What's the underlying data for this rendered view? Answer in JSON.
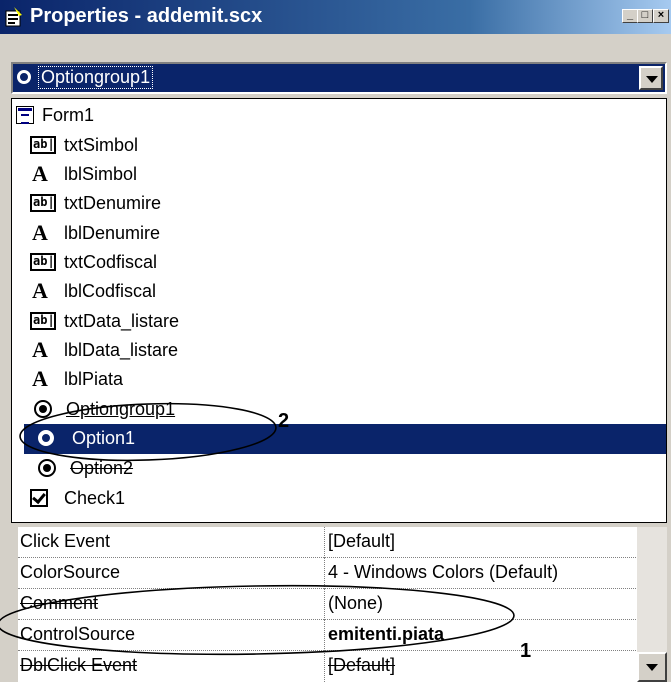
{
  "window": {
    "title": "Properties - addemit.scx"
  },
  "object_combo": {
    "selected": "Optiongroup1"
  },
  "object_list": [
    {
      "icon": "form-icon",
      "label": "Form1"
    },
    {
      "icon": "textbox-icon",
      "label": "txtSimbol"
    },
    {
      "icon": "label-icon",
      "label": "lblSimbol"
    },
    {
      "icon": "textbox-icon",
      "label": "txtDenumire"
    },
    {
      "icon": "label-icon",
      "label": "lblDenumire"
    },
    {
      "icon": "textbox-icon",
      "label": "txtCodfiscal"
    },
    {
      "icon": "label-icon",
      "label": "lblCodfiscal"
    },
    {
      "icon": "textbox-icon",
      "label": "txtData_listare"
    },
    {
      "icon": "label-icon",
      "label": "lblData_listare"
    },
    {
      "icon": "label-icon",
      "label": "lblPiata"
    },
    {
      "icon": "optiongroup-icon",
      "label": "Optiongroup1"
    },
    {
      "icon": "option-icon",
      "label": "Option1",
      "selected": true
    },
    {
      "icon": "option-icon",
      "label": "Option2"
    },
    {
      "icon": "checkbox-icon",
      "label": "Check1"
    }
  ],
  "icons": {
    "textbox_glyph": "ab|",
    "label_glyph": "A"
  },
  "properties": [
    {
      "name": "Click Event",
      "value": "[Default]"
    },
    {
      "name": "ColorSource",
      "value": "4 - Windows Colors (Default)"
    },
    {
      "name": "Comment",
      "value": "(None)"
    },
    {
      "name": "ControlSource",
      "value": "emitenti.piata",
      "bold": true
    },
    {
      "name": "DblClick Event",
      "value": "[Default]"
    }
  ],
  "annotations": {
    "one": "1",
    "two": "2"
  },
  "colors": {
    "selection": "#0a246a",
    "face": "#d4d0c8"
  }
}
